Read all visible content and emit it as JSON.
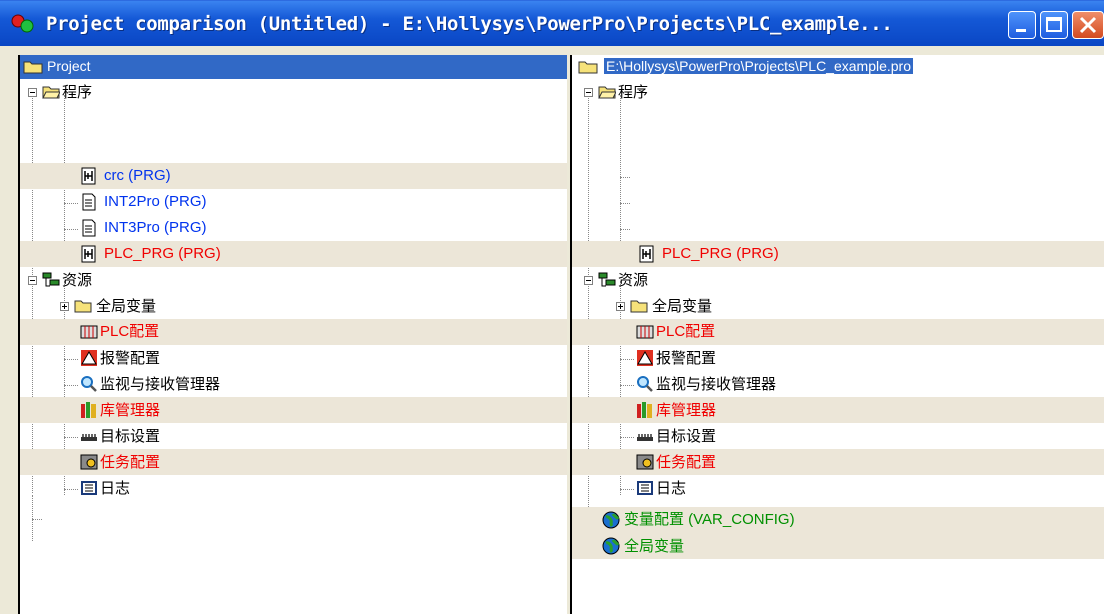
{
  "window": {
    "title": "Project comparison (Untitled) - E:\\Hollysys\\PowerPro\\Projects\\PLC_example..."
  },
  "left": {
    "header": "Project",
    "rows": [
      {
        "text": "程序",
        "color": "black",
        "hl": false
      },
      {
        "text": "crc (PRG)",
        "color": "blue",
        "hl": true
      },
      {
        "text": "INT2Pro (PRG)",
        "color": "blue",
        "hl": false
      },
      {
        "text": "INT3Pro (PRG)",
        "color": "blue",
        "hl": false
      },
      {
        "text": "PLC_PRG (PRG)",
        "color": "red",
        "hl": true
      },
      {
        "text": "资源",
        "color": "black",
        "hl": false
      },
      {
        "text": "全局变量",
        "color": "black",
        "hl": false
      },
      {
        "text": "PLC配置",
        "color": "red",
        "hl": true
      },
      {
        "text": "报警配置",
        "color": "black",
        "hl": false
      },
      {
        "text": "监视与接收管理器",
        "color": "black",
        "hl": false
      },
      {
        "text": "库管理器",
        "color": "red",
        "hl": true
      },
      {
        "text": "目标设置",
        "color": "black",
        "hl": false
      },
      {
        "text": "任务配置",
        "color": "red",
        "hl": true
      },
      {
        "text": "日志",
        "color": "black",
        "hl": false
      }
    ]
  },
  "right": {
    "header": "E:\\Hollysys\\PowerPro\\Projects\\PLC_example.pro",
    "rows": [
      {
        "text": "程序",
        "color": "black",
        "hl": false
      },
      {
        "text": "PLC_PRG (PRG)",
        "color": "red",
        "hl": true
      },
      {
        "text": "资源",
        "color": "black",
        "hl": false
      },
      {
        "text": "全局变量",
        "color": "black",
        "hl": false
      },
      {
        "text": "PLC配置",
        "color": "red",
        "hl": true
      },
      {
        "text": "报警配置",
        "color": "black",
        "hl": false
      },
      {
        "text": "监视与接收管理器",
        "color": "black",
        "hl": false
      },
      {
        "text": "库管理器",
        "color": "red",
        "hl": true
      },
      {
        "text": "目标设置",
        "color": "black",
        "hl": false
      },
      {
        "text": "任务配置",
        "color": "red",
        "hl": true
      },
      {
        "text": "日志",
        "color": "black",
        "hl": false
      },
      {
        "text": "变量配置 (VAR_CONFIG)",
        "color": "green",
        "hl": true
      },
      {
        "text": "全局变量",
        "color": "green",
        "hl": true
      }
    ]
  },
  "icons": {
    "title": "project-compare-icon",
    "folder": "folder-icon",
    "ladder": "ladder-program-icon",
    "document": "document-icon",
    "resources": "resources-icon",
    "plc_config": "plc-config-icon",
    "alarm": "alarm-icon",
    "monitor": "magnifier-icon",
    "library": "library-icon",
    "target": "target-settings-icon",
    "task": "task-config-icon",
    "log": "log-book-icon",
    "globe": "globe-icon"
  },
  "colors": {
    "title_bar": "#0a46c4",
    "panel_header": "#3169c6",
    "highlight_row": "#ece6d8",
    "text_blue": "#0033ee",
    "text_red": "#f00000",
    "text_green": "#009000"
  }
}
